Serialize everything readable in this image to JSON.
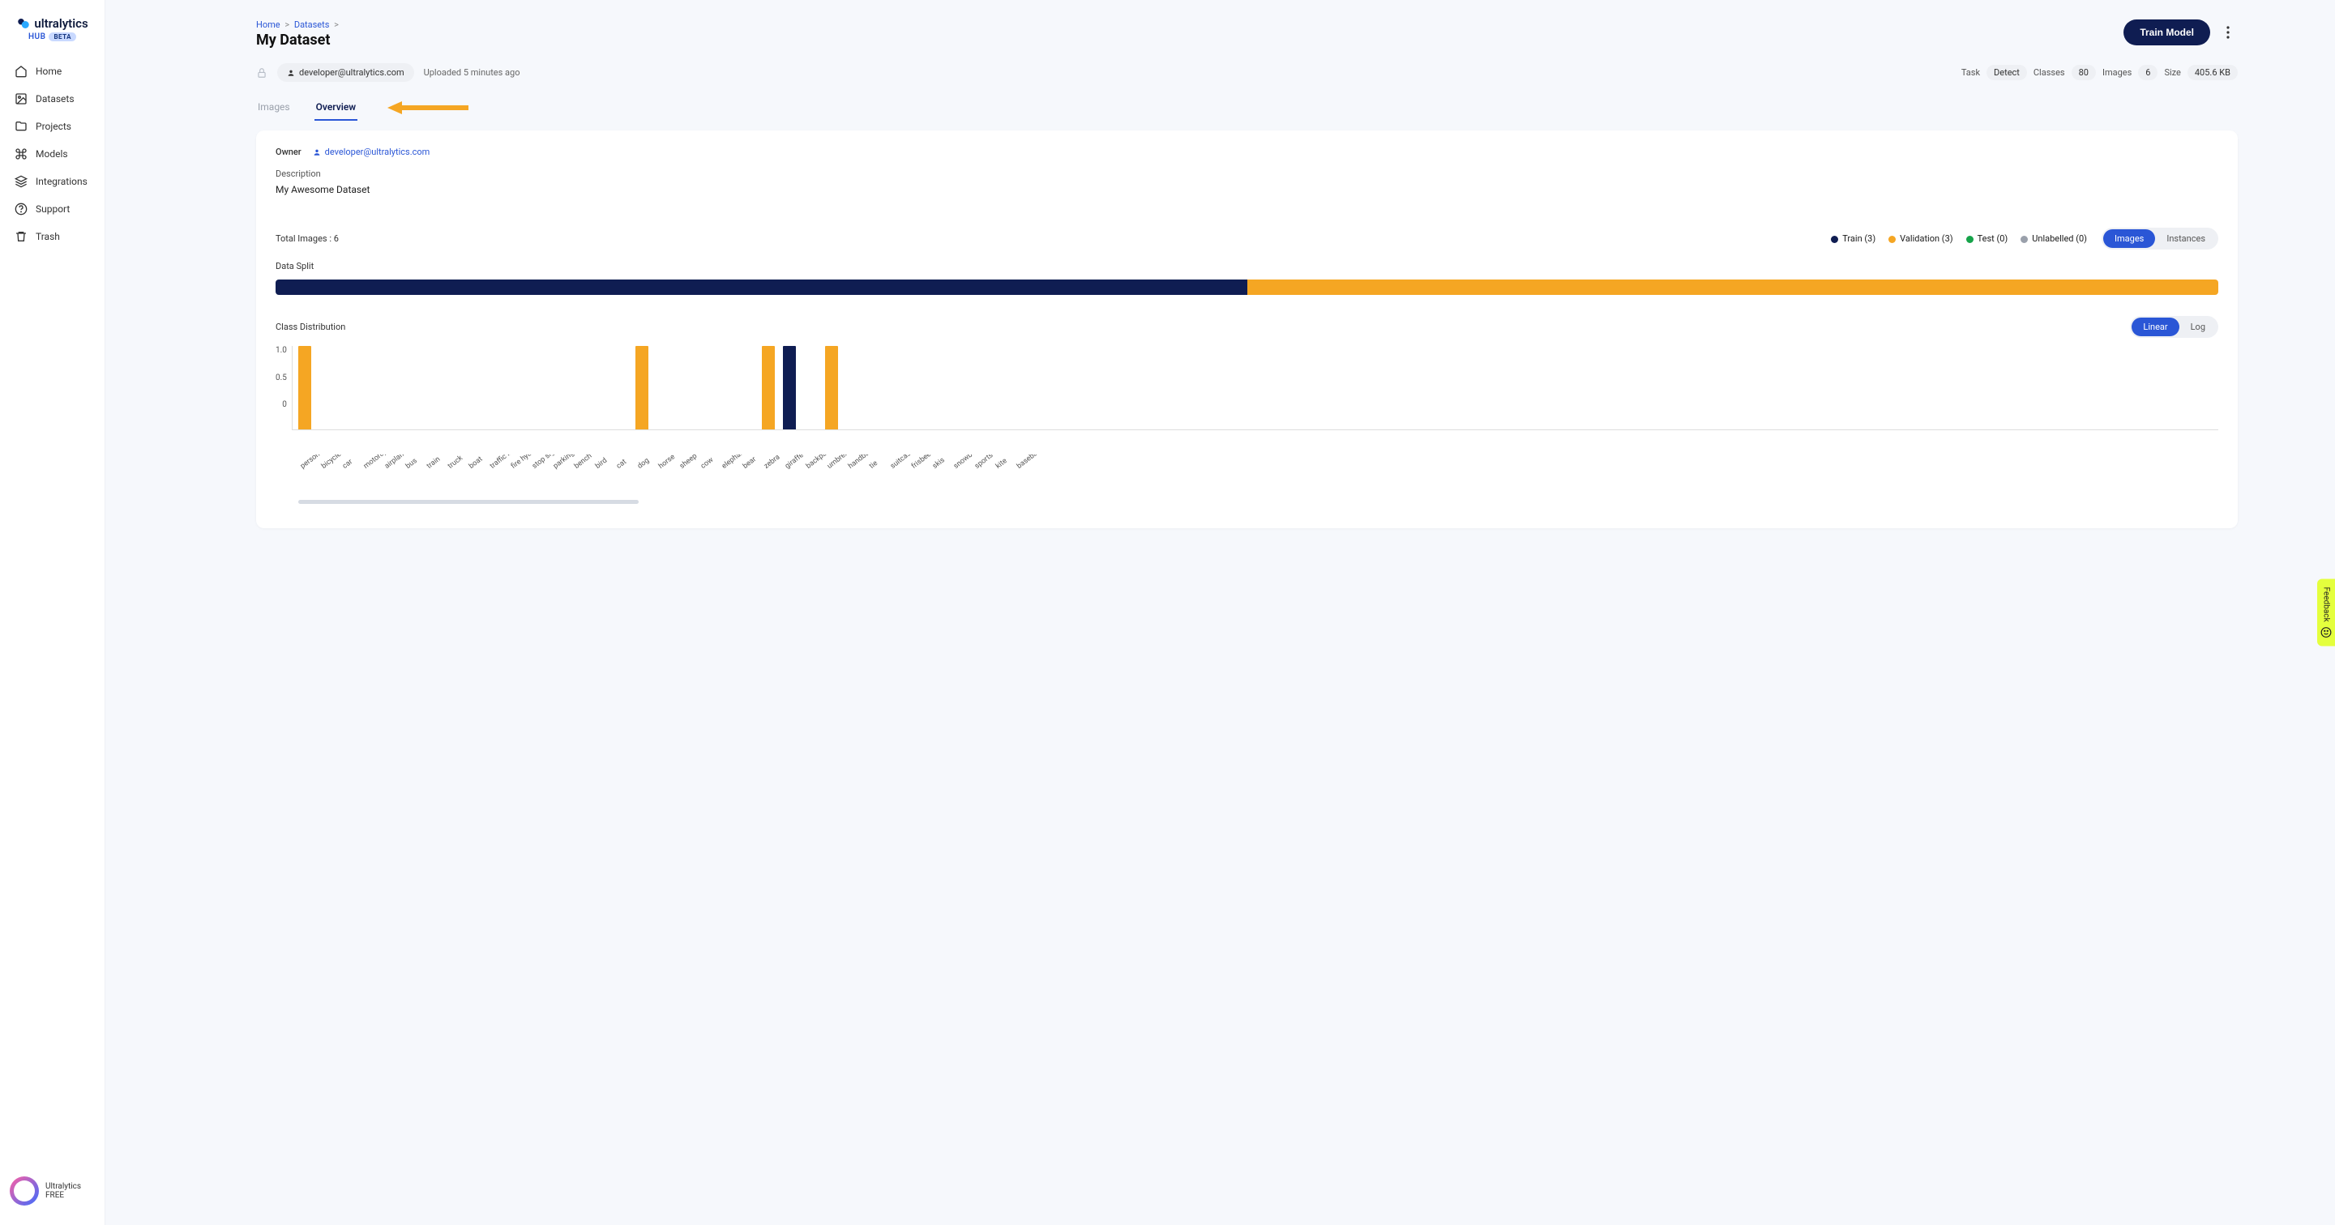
{
  "brand": {
    "name": "ultralytics",
    "sub": "HUB",
    "beta": "BETA"
  },
  "sidebar": {
    "items": [
      {
        "label": "Home"
      },
      {
        "label": "Datasets"
      },
      {
        "label": "Projects"
      },
      {
        "label": "Models"
      },
      {
        "label": "Integrations"
      },
      {
        "label": "Support"
      },
      {
        "label": "Trash"
      }
    ],
    "footer": {
      "name": "Ultralytics",
      "plan": "FREE"
    }
  },
  "breadcrumb": {
    "home": "Home",
    "datasets": "Datasets"
  },
  "page": {
    "title": "My Dataset"
  },
  "actions": {
    "train": "Train Model"
  },
  "owner_chip": "developer@ultralytics.com",
  "uploaded": "Uploaded 5 minutes ago",
  "stats": {
    "task_label": "Task",
    "task": "Detect",
    "classes_label": "Classes",
    "classes": "80",
    "images_label": "Images",
    "images": "6",
    "size_label": "Size",
    "size": "405.6 KB"
  },
  "tabs": {
    "images": "Images",
    "overview": "Overview"
  },
  "overview": {
    "owner_label": "Owner",
    "owner": "developer@ultralytics.com",
    "desc_label": "Description",
    "desc": "My Awesome Dataset",
    "total_images": "Total Images : 6",
    "data_split_label": "Data Split",
    "legend": {
      "train": "Train (3)",
      "val": "Validation (3)",
      "test": "Test (0)",
      "unl": "Unlabelled (0)"
    },
    "toggle1": {
      "images": "Images",
      "instances": "Instances"
    },
    "class_dist": "Class Distribution",
    "toggle2": {
      "linear": "Linear",
      "log": "Log"
    },
    "yticks": {
      "t1": "1.0",
      "t05": "0.5",
      "t0": "0"
    }
  },
  "feedback": "Feedback",
  "chart_data": {
    "split": {
      "type": "bar",
      "categories": [
        "Train",
        "Validation",
        "Test",
        "Unlabelled"
      ],
      "values": [
        3,
        3,
        0,
        0
      ]
    },
    "class_distribution": {
      "type": "bar",
      "ylim": [
        0,
        1
      ],
      "series": [
        {
          "name": "Validation",
          "color": "#f5a623"
        },
        {
          "name": "Train",
          "color": "#0f1d52"
        }
      ],
      "categories": [
        "person",
        "bicycle",
        "car",
        "motorcycle",
        "airplane",
        "bus",
        "train",
        "truck",
        "boat",
        "traffic light",
        "fire hydrant",
        "stop sign",
        "parking meter",
        "bench",
        "bird",
        "cat",
        "dog",
        "horse",
        "sheep",
        "cow",
        "elephant",
        "bear",
        "zebra",
        "giraffe",
        "backpack",
        "umbrella",
        "handbag",
        "tie",
        "suitcase",
        "frisbee",
        "skis",
        "snowboard",
        "sports ball",
        "kite",
        "baseball bat"
      ],
      "bars": [
        {
          "cat": "person",
          "series": "Validation",
          "value": 1.0
        },
        {
          "cat": "dog",
          "series": "Validation",
          "value": 1.0
        },
        {
          "cat": "zebra",
          "series": "Validation",
          "value": 1.0
        },
        {
          "cat": "giraffe",
          "series": "Train",
          "value": 1.0
        },
        {
          "cat": "umbrella",
          "series": "Validation",
          "value": 1.0
        }
      ]
    }
  }
}
